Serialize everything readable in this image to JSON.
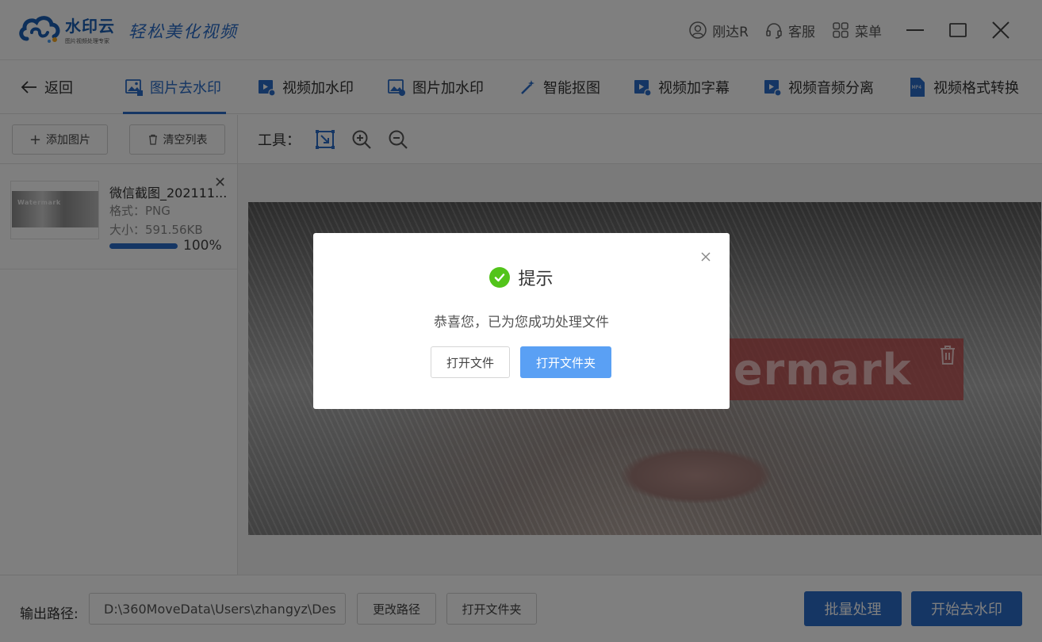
{
  "app": {
    "logo_name": "水印云",
    "logo_sub": "图片视频处理专家",
    "slogan": "轻松美化视频"
  },
  "titlebar": {
    "user": "刚达R",
    "service": "客服",
    "menu": "菜单"
  },
  "nav": {
    "back": "返回",
    "tabs": [
      {
        "label": "图片去水印",
        "active": true
      },
      {
        "label": "视频加水印"
      },
      {
        "label": "图片加水印"
      },
      {
        "label": "智能抠图"
      },
      {
        "label": "视频加字幕"
      },
      {
        "label": "视频音频分离"
      },
      {
        "label": "视频格式转换"
      }
    ]
  },
  "left": {
    "add_label": "添加图片",
    "clear_label": "清空列表",
    "files": [
      {
        "name": "微信截图_202111...",
        "format": "格式：PNG",
        "size": "大小：591.56KB",
        "progress": "100%",
        "thumb_watermark": "Watermark"
      }
    ]
  },
  "toolbar": {
    "label": "工具："
  },
  "canvas": {
    "watermark_text": "ermark"
  },
  "bottom": {
    "output_label": "输出路径:",
    "output_path": "D:\\360MoveData\\Users\\zhangyz\\Des",
    "change_path": "更改路径",
    "open_folder": "打开文件夹",
    "batch": "批量处理",
    "start": "开始去水印"
  },
  "dialog": {
    "title": "提示",
    "message": "恭喜您，已为您成功处理文件",
    "open_file": "打开文件",
    "open_folder": "打开文件夹"
  },
  "colors": {
    "accent": "#2a6cc8",
    "success": "#52c41a",
    "dialog_primary": "#5aa0f4"
  }
}
